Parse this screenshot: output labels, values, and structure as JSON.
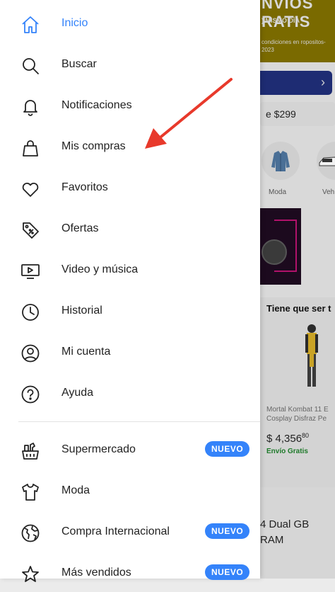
{
  "drawer": {
    "items": [
      {
        "label": "Inicio",
        "icon": "home-icon",
        "active": true
      },
      {
        "label": "Buscar",
        "icon": "search-icon"
      },
      {
        "label": "Notificaciones",
        "icon": "bell-icon"
      },
      {
        "label": "Mis compras",
        "icon": "shopping-bag-icon"
      },
      {
        "label": "Favoritos",
        "icon": "heart-icon"
      },
      {
        "label": "Ofertas",
        "icon": "tag-icon"
      },
      {
        "label": "Video y música",
        "icon": "video-play-icon"
      },
      {
        "label": "Historial",
        "icon": "clock-icon"
      },
      {
        "label": "Mi cuenta",
        "icon": "user-circle-icon"
      },
      {
        "label": "Ayuda",
        "icon": "help-icon"
      }
    ],
    "secondary_items": [
      {
        "label": "Supermercado",
        "icon": "grocery-basket-icon",
        "badge": "NUEVO"
      },
      {
        "label": "Moda",
        "icon": "tshirt-icon"
      },
      {
        "label": "Compra Internacional",
        "icon": "globe-icon",
        "badge": "NUEVO"
      },
      {
        "label": "Más vendidos",
        "icon": "star-icon",
        "badge": "NUEVO"
      }
    ]
  },
  "background": {
    "banner": {
      "title": "NVIOS RATIS",
      "subtitle": ") MISMO DÍA",
      "terms": "condiciones en ropositos-2023"
    },
    "shipping_text": "e $299",
    "categories": [
      "Moda",
      "Veh"
    ],
    "section_title": "Tiene que ser t",
    "product": {
      "title": "Mortal Kombat 11 E Cosplay Disfraz Pe",
      "price": "$ 4,356",
      "cents": "80",
      "shipping": "Envío Gratis"
    },
    "card_text": "4 Dual GB RAM"
  },
  "colors": {
    "accent": "#3483fa",
    "annotation_arrow": "#e8392b"
  }
}
